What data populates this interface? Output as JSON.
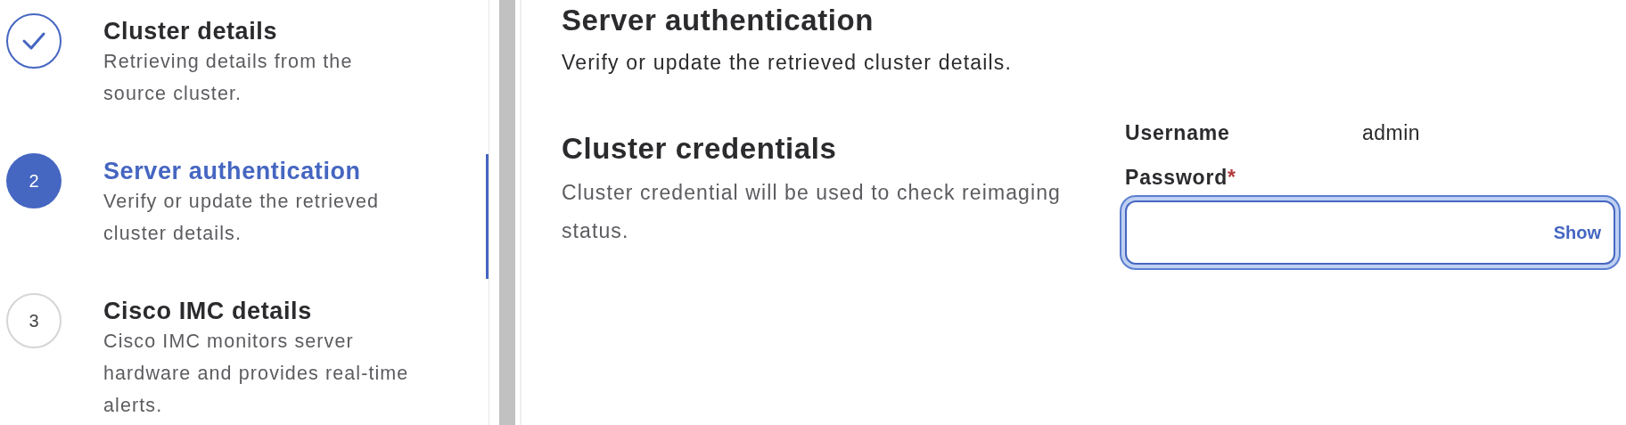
{
  "steps": [
    {
      "kind": "done",
      "selected": false,
      "title": "Cluster details",
      "description": "Retrieving details from the source cluster."
    },
    {
      "kind": "current",
      "selected": true,
      "number": "2",
      "title": "Server authentication",
      "description": "Verify or update the retrieved cluster details."
    },
    {
      "kind": "upcoming",
      "selected": false,
      "number": "3",
      "title": "Cisco IMC details",
      "description": "Cisco IMC monitors server hardware and provides real-time alerts."
    }
  ],
  "page": {
    "title": "Server authentication",
    "subtitle": "Verify or update the retrieved cluster details."
  },
  "section": {
    "title": "Cluster credentials",
    "description": "Cluster credential will be used to check reimaging status."
  },
  "username": {
    "label": "Username",
    "value": "admin"
  },
  "password": {
    "label": "Password",
    "required_mark": "*",
    "focused": true,
    "toggle": "Show"
  }
}
